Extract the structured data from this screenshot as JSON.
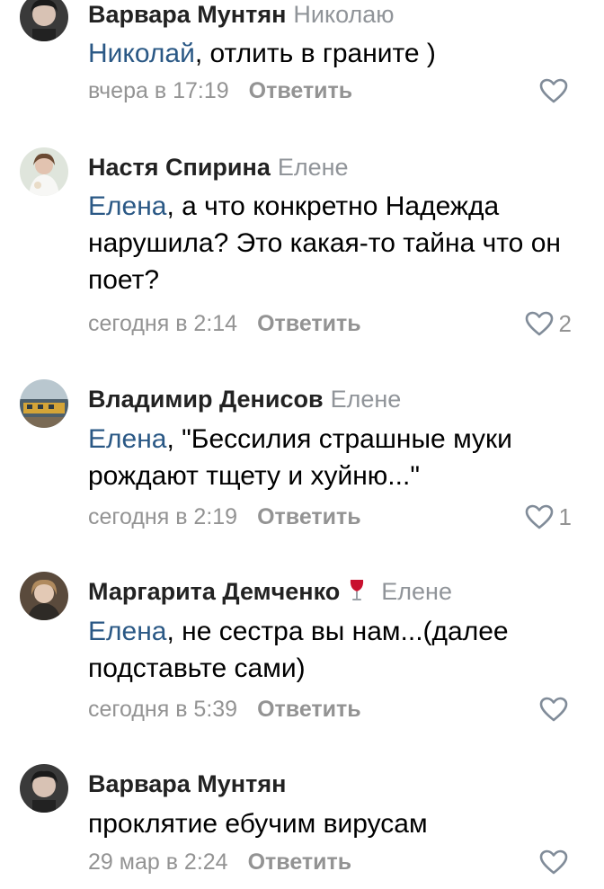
{
  "comments": [
    {
      "author": "Варвара Мунтян",
      "reply_to": "Николаю",
      "mention": "Николай",
      "text": ", отлить в граните )",
      "date": "вчера в 17:19",
      "reply_label": "Ответить",
      "likes": ""
    },
    {
      "author": "Настя Спирина",
      "reply_to": "Елене",
      "mention": "Елена",
      "text": ", а что конкретно Надежда нарушила? Это какая-то тайна что он поет?",
      "date": "сегодня в 2:14",
      "reply_label": "Ответить",
      "likes": "2"
    },
    {
      "author": "Владимир Денисов",
      "reply_to": "Елене",
      "mention": "Елена",
      "text": ", \"Бессилия страшные муки рождают тщету и хуйню...\"",
      "date": "сегодня в 2:19",
      "reply_label": "Ответить",
      "likes": "1"
    },
    {
      "author": "Маргарита Демченко",
      "author_badge": "wine-glass-emoji",
      "reply_to": "Елене",
      "mention": "Елена",
      "text": ", не сестра вы нам...(далее подставьте сами)",
      "date": "сегодня в 5:39",
      "reply_label": "Ответить",
      "likes": ""
    },
    {
      "author": "Варвара Мунтян",
      "reply_to": "",
      "mention": "",
      "text": "проклятие ебучим вирусам",
      "date": "29 мар в 2:24",
      "reply_label": "Ответить",
      "likes": ""
    }
  ],
  "colors": {
    "mention": "#2a5885",
    "secondary_text": "#939393",
    "author": "#222222",
    "like_icon": "#818c99"
  },
  "icons": {
    "like": "heart-outline-icon"
  }
}
